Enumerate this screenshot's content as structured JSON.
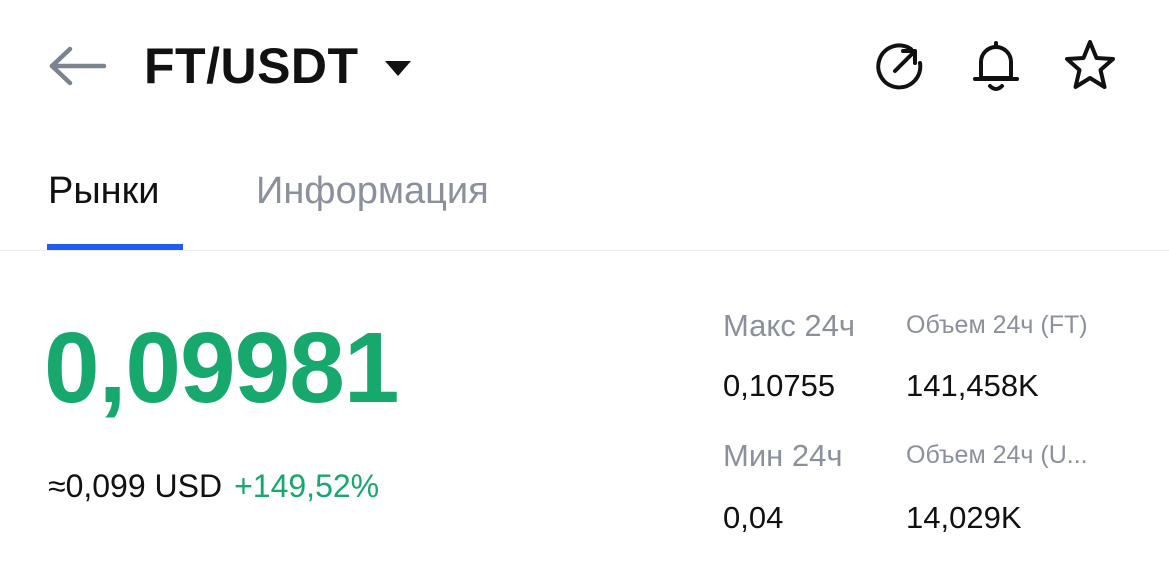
{
  "header": {
    "pair": "FT/USDT",
    "icons": [
      "back-arrow-icon",
      "chevron-down-icon",
      "chart-icon",
      "bell-icon",
      "star-icon"
    ]
  },
  "tabs": [
    {
      "label": "Рынки",
      "active": true
    },
    {
      "label": "Информация",
      "active": false
    }
  ],
  "market": {
    "price": "0,09981",
    "usd_approx": "≈0,099 USD",
    "change": "+149,52%",
    "high_label": "Макс 24ч",
    "high_value": "0,10755",
    "low_label": "Мин 24ч",
    "low_value": "0,04",
    "vol_base_label": "Объем 24ч (FT)",
    "vol_base_value": "141,458K",
    "vol_quote_label": "Объем 24ч  (U...",
    "vol_quote_value": "14,029K"
  },
  "colors": {
    "accent_green": "#17a86d",
    "tab_underline": "#1f5cf0",
    "muted_text": "#8b919c",
    "primary_text": "#111111"
  }
}
